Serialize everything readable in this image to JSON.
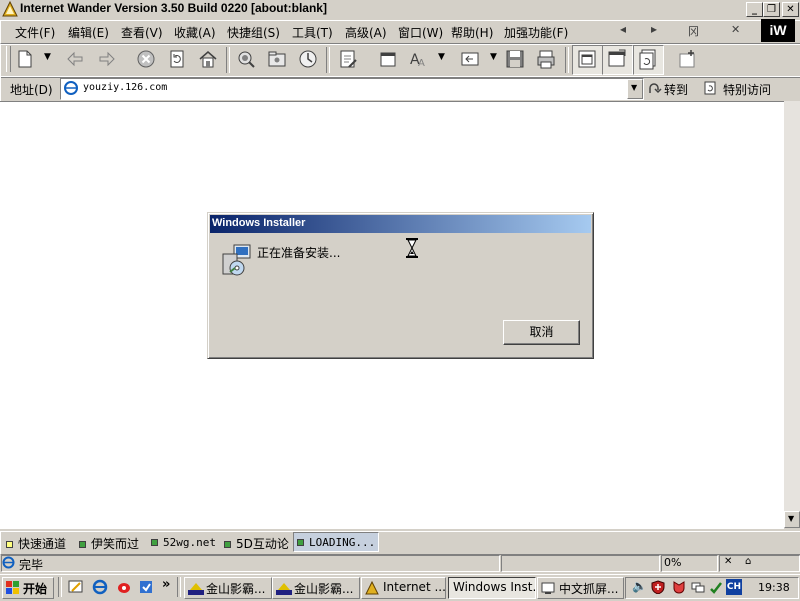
{
  "window": {
    "title": "Internet Wander Version 3.50 Build 0220 [about:blank]",
    "logo_text": "iW",
    "controls": {
      "minimize": "_",
      "restore": "❐",
      "close": "✕"
    }
  },
  "menu": {
    "items": [
      "文件(F)",
      "编辑(E)",
      "查看(V)",
      "收藏(A)",
      "快捷组(S)",
      "工具(T)",
      "高级(A)",
      "窗口(W)",
      "帮助(H)",
      "加强功能(F)"
    ],
    "nav_left": "◂",
    "nav_right": "▸",
    "glyph": "冈",
    "close": "✕"
  },
  "address": {
    "label": "地址(D)",
    "value": "youziy.126.com",
    "go_label": "转到",
    "special_label": "特别访问"
  },
  "dialog": {
    "title": "Windows Installer",
    "message": "正在准备安装...",
    "cancel_label": "取消"
  },
  "links": {
    "items": [
      "快速通道",
      "伊笑而过",
      "52wg.net",
      "5D互动论",
      "LOADING..."
    ],
    "colors": [
      "#ffff80",
      "#40a040",
      "#40a040",
      "#40a040",
      "#40a040"
    ]
  },
  "status": {
    "text": "完毕",
    "progress": "0%",
    "close": "✕",
    "lock": "⌂"
  },
  "taskbar": {
    "start_label": "开始",
    "quicklaunch_more": "»",
    "tasks": [
      "金山影霸...",
      "金山影霸...",
      "Internet ...",
      "Windows Inst...",
      "中文抓屏..."
    ],
    "ime": "CH",
    "time": "19:38"
  },
  "colors": {
    "titlebar_gradient_start": "#0a246a",
    "titlebar_gradient_end": "#a6caf0",
    "face": "#d4d0c8",
    "content_bg": "#ffffff"
  }
}
